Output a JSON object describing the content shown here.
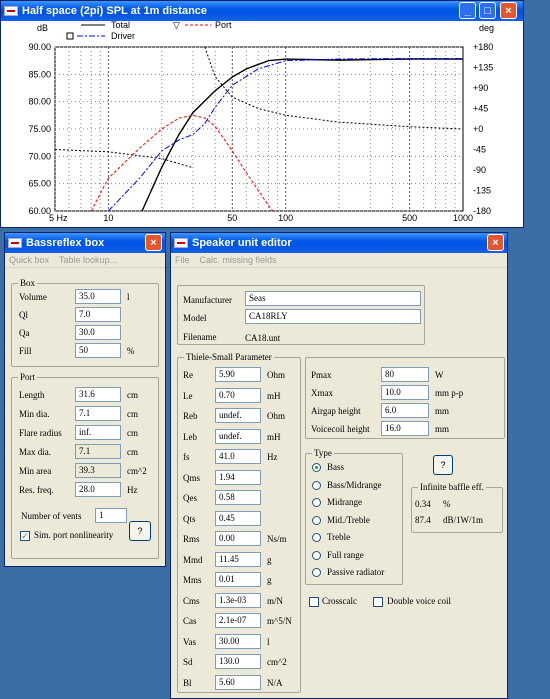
{
  "chart_window": {
    "title": "Half space (2pi) SPL at 1m distance",
    "legend": {
      "total": "Total",
      "port": "Port",
      "driver": "Driver"
    },
    "left_unit": "dB",
    "right_unit": "deg",
    "colors": {
      "total": "#000000",
      "port": "#ff0000",
      "driver": "#0000ff",
      "phase": "#000000"
    }
  },
  "chart_data": {
    "type": "line",
    "x_scale": "log",
    "xlim": [
      5,
      1000
    ],
    "x_ticks": [
      "5 Hz",
      "10",
      "50",
      "100",
      "500",
      "1000"
    ],
    "x_tick_values": [
      5,
      10,
      50,
      100,
      500,
      1000
    ],
    "ylim": [
      60,
      90
    ],
    "y_ticks": [
      "60.00",
      "65.00",
      "70.00",
      "75.00",
      "80.00",
      "85.00",
      "90.00"
    ],
    "y2lim": [
      -180,
      180
    ],
    "y2_ticks": [
      "+180",
      "+135",
      "+90",
      "+45",
      "+0",
      "-45",
      "-90",
      "-135",
      "-180"
    ],
    "grid": true,
    "series": [
      {
        "name": "Total",
        "x": [
          5,
          10,
          15,
          20,
          25,
          30,
          40,
          50,
          60,
          80,
          100,
          200,
          500,
          1000
        ],
        "y": [
          45,
          51,
          59,
          68,
          74,
          78,
          82,
          84.5,
          86,
          87.5,
          87.8,
          87.6,
          87.8,
          87.8
        ]
      },
      {
        "name": "Port",
        "x": [
          8,
          10,
          15,
          20,
          25,
          30,
          35,
          40,
          50,
          60,
          80,
          100,
          120
        ],
        "y": [
          60,
          66,
          71.5,
          75,
          77,
          77.5,
          77,
          75.5,
          71,
          67,
          61,
          57,
          54
        ]
      },
      {
        "name": "Driver",
        "x": [
          10,
          15,
          20,
          25,
          30,
          35,
          40,
          50,
          70,
          100,
          200,
          500,
          1000
        ],
        "y": [
          60,
          66,
          71,
          73,
          74,
          76,
          79,
          83,
          86,
          87.5,
          87.8,
          87.9,
          87.9
        ]
      },
      {
        "name": "Phase",
        "axis": "y2",
        "x": [
          5,
          10,
          20,
          30,
          35,
          40,
          50,
          70,
          100,
          200,
          500,
          1000
        ],
        "y": [
          -45,
          -50,
          -65,
          -85,
          180,
          115,
          70,
          45,
          30,
          15,
          5,
          0
        ]
      }
    ]
  },
  "bassreflex": {
    "title": "Bassreflex box",
    "menu": [
      "Quick box",
      "Table lookup..."
    ],
    "box_group": "Box",
    "box_fields": [
      {
        "label": "Volume",
        "value": "35.0",
        "unit": "l"
      },
      {
        "label": "Ql",
        "value": "7.0",
        "unit": ""
      },
      {
        "label": "Qa",
        "value": "30.0",
        "unit": ""
      },
      {
        "label": "Fill",
        "value": "50",
        "unit": "%"
      }
    ],
    "port_group": "Port",
    "port_fields": [
      {
        "label": "Length",
        "value": "31.6",
        "unit": "cm"
      },
      {
        "label": "Min dia.",
        "value": "7.1",
        "unit": "cm"
      },
      {
        "label": "Flare radius",
        "value": "inf.",
        "unit": "cm"
      },
      {
        "label": "Max dia.",
        "value": "7.1",
        "unit": "cm"
      },
      {
        "label": "Min area",
        "value": "39.3",
        "unit": "cm^2"
      },
      {
        "label": "Res. freq.",
        "value": "28.0",
        "unit": "Hz"
      }
    ],
    "vents_label": "Number of vents",
    "vents_value": "1",
    "nonlin_label": "Sim. port nonlinearity",
    "help_button": "?"
  },
  "speaker": {
    "title": "Speaker unit editor",
    "menu": [
      "File",
      "Calc. missing fields"
    ],
    "manufacturer_label": "Manufacturer",
    "manufacturer": "Seas",
    "model_label": "Model",
    "model": "CA18RLY",
    "filename_label": "Filename",
    "filename": "CA18.unt",
    "ts_group": "Thiele-Small Parameter",
    "ts_fields": [
      {
        "label": "Re",
        "value": "5.90",
        "unit": "Ohm"
      },
      {
        "label": "Le",
        "value": "0.70",
        "unit": "mH"
      },
      {
        "label": "Reb",
        "value": "undef.",
        "unit": "Ohm"
      },
      {
        "label": "Leb",
        "value": "undef.",
        "unit": "mH"
      },
      {
        "label": "fs",
        "value": "41.0",
        "unit": "Hz"
      },
      {
        "label": "Qms",
        "value": "1.94",
        "unit": ""
      },
      {
        "label": "Qes",
        "value": "0.58",
        "unit": ""
      },
      {
        "label": "Qts",
        "value": "0.45",
        "unit": ""
      },
      {
        "label": "Rms",
        "value": "0.00",
        "unit": "Ns/m"
      },
      {
        "label": "Mmd",
        "value": "11.45",
        "unit": "g"
      },
      {
        "label": "Mms",
        "value": "0.01",
        "unit": "g"
      },
      {
        "label": "Cms",
        "value": "1.3e-03",
        "unit": "m/N"
      },
      {
        "label": "Cas",
        "value": "2.1e-07",
        "unit": "m^5/N"
      },
      {
        "label": "Vas",
        "value": "30.00",
        "unit": "l"
      },
      {
        "label": "Sd",
        "value": "130.0",
        "unit": "cm^2"
      },
      {
        "label": "Bl",
        "value": "5.60",
        "unit": "N/A"
      }
    ],
    "right_fields": [
      {
        "label": "Pmax",
        "value": "80",
        "unit": "W"
      },
      {
        "label": "Xmax",
        "value": "10.0",
        "unit": "mm p-p"
      },
      {
        "label": "Airgap height",
        "value": "6.0",
        "unit": "mm"
      },
      {
        "label": "Voicecoil height",
        "value": "16.0",
        "unit": "mm"
      }
    ],
    "type_group": "Type",
    "types": [
      "Bass",
      "Bass/Midrange",
      "Midrange",
      "Mid./Treble",
      "Treble",
      "Full range",
      "Passive radiator"
    ],
    "selected_type": "Bass",
    "help_button": "?",
    "baffle_group": "Infinite baffle eff.",
    "baffle_pct": "0.34",
    "baffle_pct_unit": "%",
    "baffle_db": "87.4",
    "baffle_db_unit": "dB/1W/1m",
    "crosscalc_label": "Crosscalc",
    "double_vc_label": "Double voice coil"
  }
}
